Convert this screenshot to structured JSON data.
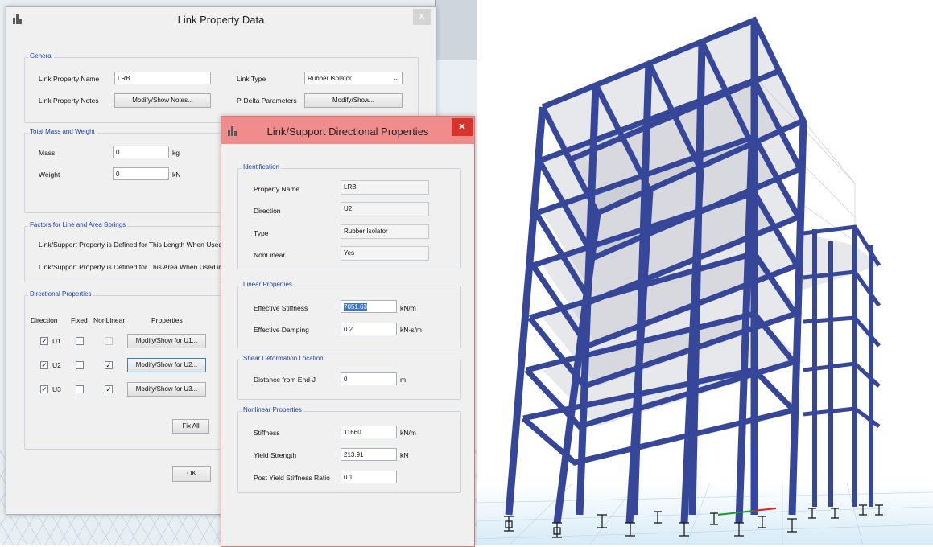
{
  "main_dialog": {
    "title": "Link Property Data",
    "general": {
      "label": "General",
      "name_label": "Link Property Name",
      "name_value": "LRB",
      "notes_label": "Link Property Notes",
      "notes_button": "Modify/Show Notes...",
      "type_label": "Link Type",
      "type_value": "Rubber Isolator",
      "pdelta_label": "P-Delta Parameters",
      "pdelta_button": "Modify/Show..."
    },
    "mass": {
      "label": "Total Mass and Weight",
      "mass_label": "Mass",
      "mass_value": "0",
      "mass_unit": "kg",
      "weight_label": "Weight",
      "weight_value": "0",
      "weight_unit": "kN"
    },
    "factors": {
      "label": "Factors for Line and Area Springs",
      "line_text": "Link/Support Property is Defined for This Length When Used in a L",
      "area_text": "Link/Support Property is Defined for This Area When Used in an A"
    },
    "directional": {
      "label": "Directional Properties",
      "headers": [
        "Direction",
        "Fixed",
        "NonLinear",
        "Properties"
      ],
      "rows": [
        {
          "dir": "U1",
          "button": "Modify/Show for U1..."
        },
        {
          "dir": "U2",
          "button": "Modify/Show for U2..."
        },
        {
          "dir": "U3",
          "button": "Modify/Show for U3..."
        }
      ],
      "fix_all": "Fix All"
    },
    "ok": "OK"
  },
  "sub_dialog": {
    "title": "Link/Support Directional Properties",
    "identification": {
      "label": "Identification",
      "rows": [
        {
          "label": "Property Name",
          "value": "LRB"
        },
        {
          "label": "Direction",
          "value": "U2"
        },
        {
          "label": "Type",
          "value": "Rubber Isolator"
        },
        {
          "label": "NonLinear",
          "value": "Yes"
        }
      ]
    },
    "linear": {
      "label": "Linear Properties",
      "stiff_label": "Effective Stiffness",
      "stiff_value": "7051.63",
      "stiff_unit": "kN/m",
      "damp_label": "Effective Damping",
      "damp_value": "0.2",
      "damp_unit": "kN-s/m"
    },
    "shear": {
      "label": "Shear Deformation Location",
      "dist_label": "Distance from End-J",
      "dist_value": "0",
      "dist_unit": "m"
    },
    "nonlinear": {
      "label": "Nonlinear Properties",
      "stiff_label": "Stiffness",
      "stiff_value": "11660",
      "stiff_unit": "kN/m",
      "yield_label": "Yield Strength",
      "yield_value": "213.91",
      "yield_unit": "kN",
      "ratio_label": "Post Yield Stiffness Ratio",
      "ratio_value": "0.1"
    }
  },
  "colors": {
    "dialog_bg": "#f0f0f0",
    "group_label": "#1a3fa6",
    "sub_title_bar": "#f08c8c",
    "close_red": "#d9342b",
    "frame_blue": "#36479a",
    "slab": "#c9ced6"
  }
}
